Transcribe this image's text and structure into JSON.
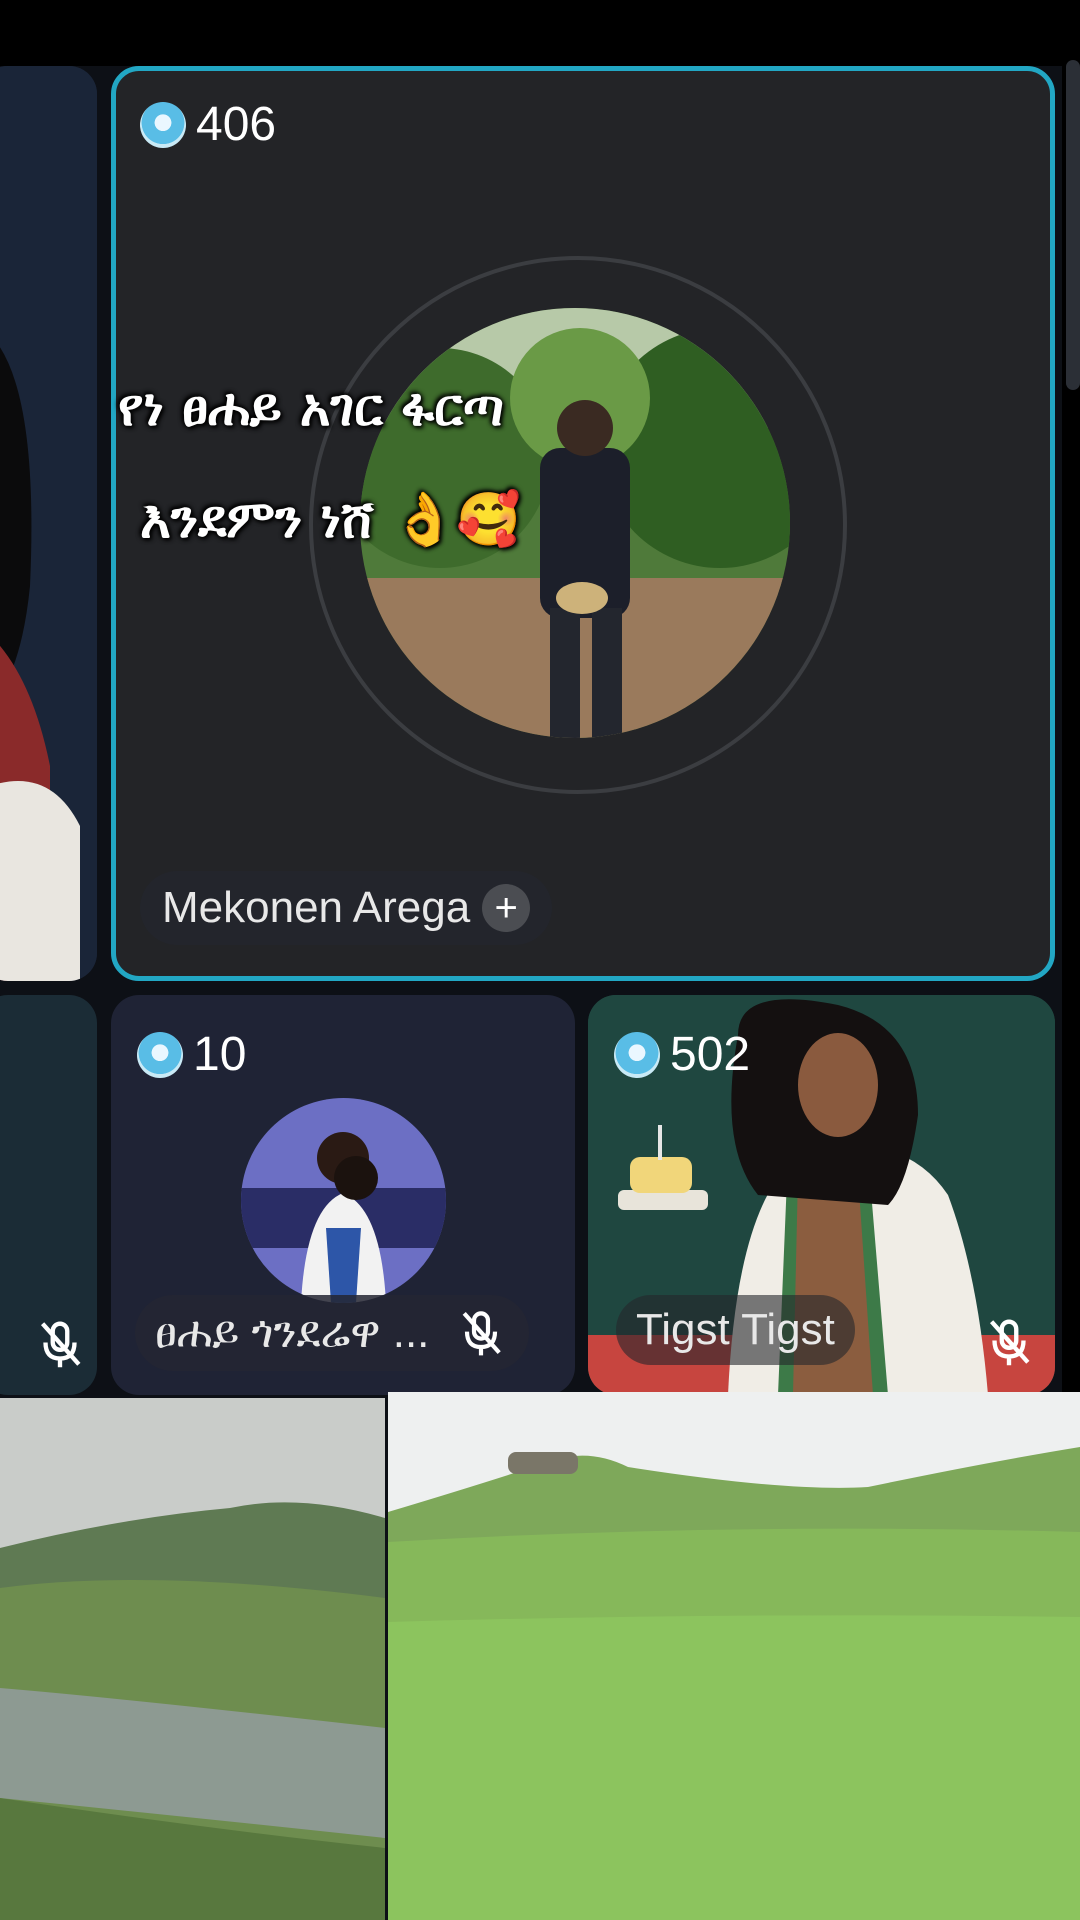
{
  "speaker_tile": {
    "score": "406",
    "name": "Mekonen Arega",
    "follow_icon": "plus-icon"
  },
  "overlay_caption": {
    "line1": "የነ ፀሐይ አገር ፋርጣ",
    "line2": "እንደምን ነሸ",
    "emoji": "👌🥰"
  },
  "participants": [
    {
      "score": "10",
      "name": "ፀሐይ ጎንደሬዋ ...",
      "mic_icon": "mic-off-icon"
    },
    {
      "score": "502",
      "name": "Tigst Tigst",
      "mic_icon": "mic-off-icon"
    }
  ],
  "colors": {
    "active_border": "#22a7c4",
    "tile_bg": "#232427",
    "chip_bg": "#24262c",
    "badge_gem": "#59bde6"
  }
}
